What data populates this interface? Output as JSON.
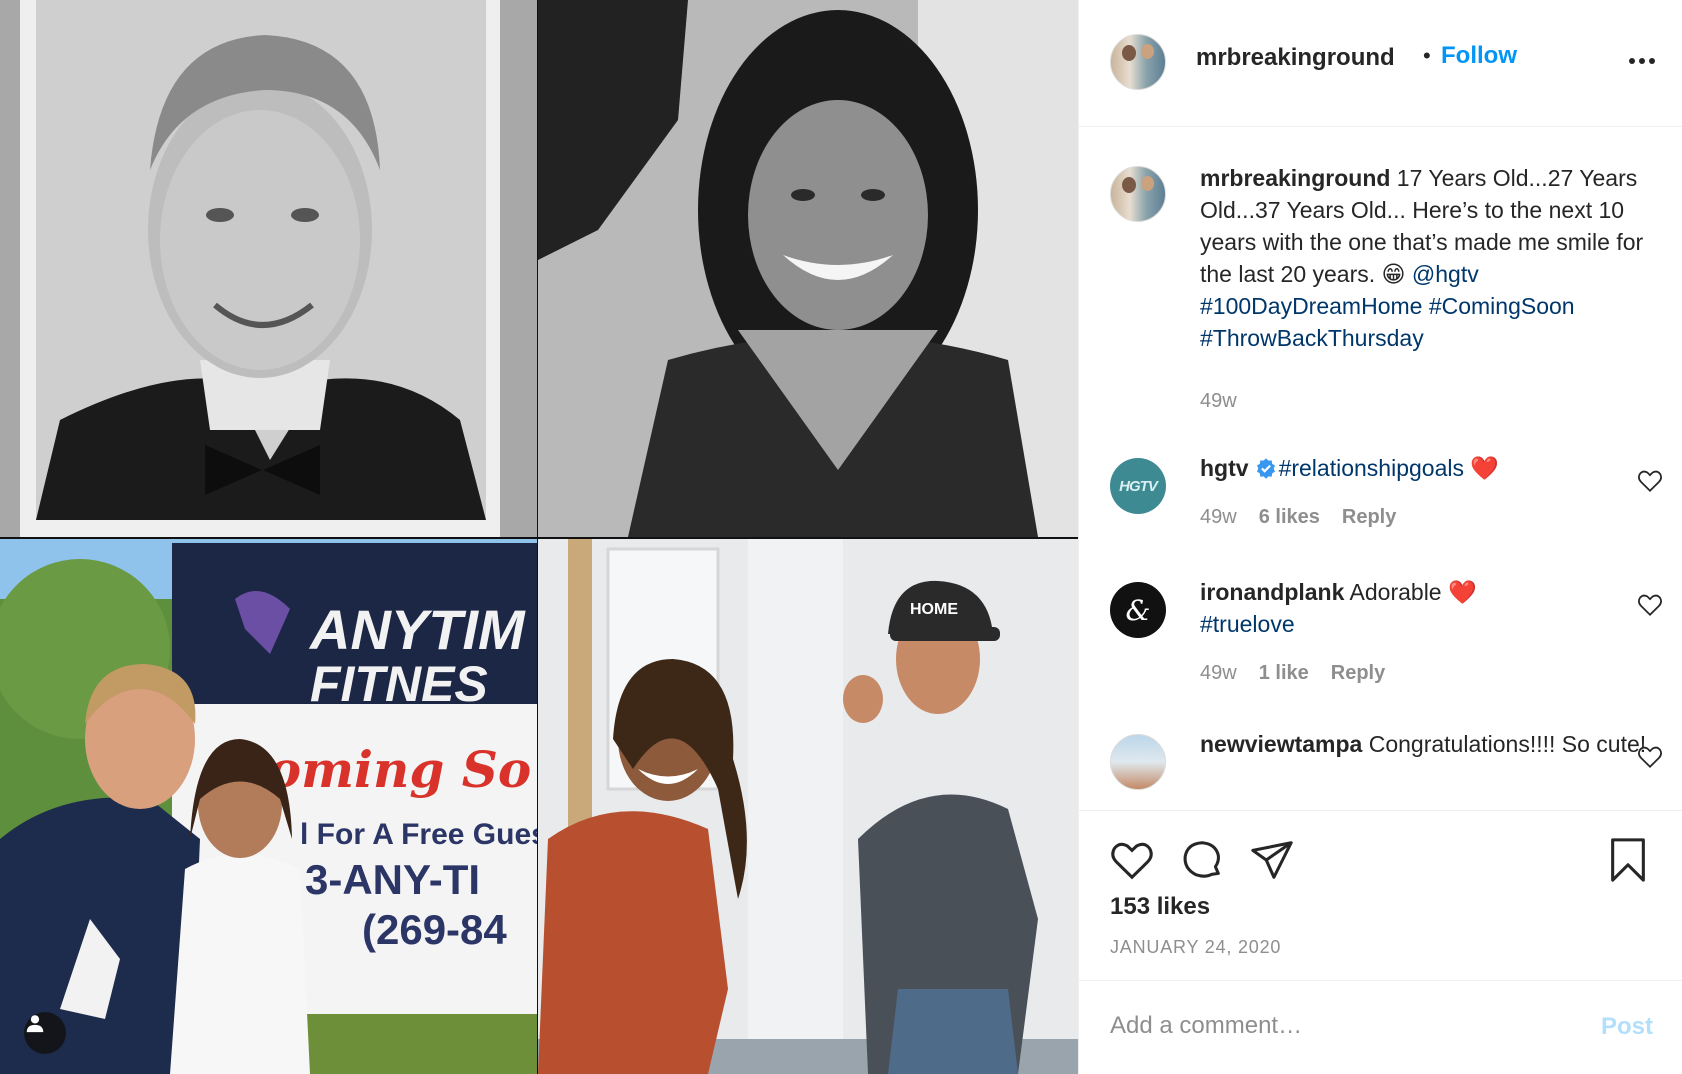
{
  "post": {
    "username": "mrbreakinground",
    "follow_label": "Follow",
    "separator": "•",
    "caption_text": " 17 Years Old...27 Years Old...37 Years Old... Here’s to the next 10 years with the one that’s made me smile for the last 20 years. 😁",
    "caption_tags": [
      "@hgtv",
      "#100DayDreamHome",
      "#ComingSoon",
      "#ThrowBackThursday"
    ],
    "caption_time": "49w",
    "likes": "153 likes",
    "date": "JANUARY 24, 2020"
  },
  "comments": [
    {
      "username": "hgtv",
      "verified": true,
      "tag": "#relationshipgoals",
      "text": "",
      "emoji": "❤️",
      "time": "49w",
      "likes": "6 likes",
      "reply": "Reply",
      "avatar_text": "HGTV"
    },
    {
      "username": "ironandplank",
      "verified": false,
      "text": " Adorable ",
      "emoji": "❤️",
      "tag": "#truelove",
      "time": "49w",
      "likes": "1 like",
      "reply": "Reply",
      "avatar_text": "&"
    },
    {
      "username": "newviewtampa",
      "verified": false,
      "text": " Congratulations!!!! So cute!"
    }
  ],
  "media": {
    "sign_brand_1": "ANYTIM",
    "sign_brand_2": "FITNES",
    "sign_coming": "Coming So",
    "sign_line_1": "l For A Free Guest",
    "sign_line_2": "3-ANY-TI",
    "sign_line_3": "(269-84",
    "cap_text": "HOME"
  },
  "add_comment": {
    "placeholder": "Add a comment…",
    "post_label": "Post"
  },
  "colors": {
    "link": "#0095f6",
    "hashtag": "#00376b",
    "muted": "#8e8e8e",
    "heart": "#ed4956"
  },
  "icons": [
    "more-icon",
    "heart-icon",
    "comment-icon",
    "share-icon",
    "bookmark-icon",
    "verified-icon",
    "user-tag-icon"
  ]
}
